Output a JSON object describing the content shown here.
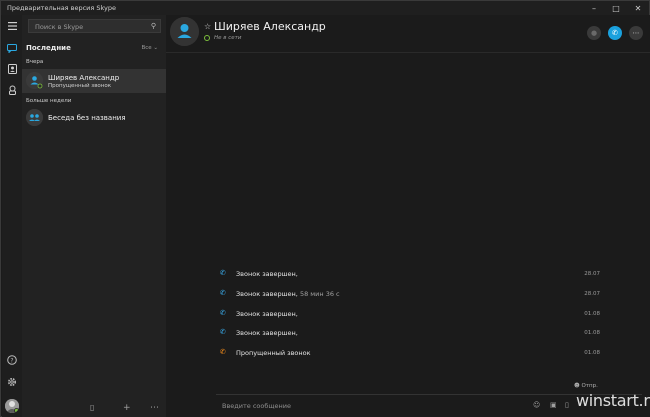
{
  "window": {
    "title": "Предварительная версия Skype",
    "controls": [
      "minimize",
      "maximize",
      "close"
    ]
  },
  "sidebar": {
    "search_placeholder": "Поиск в Skype",
    "section_title": "Последние",
    "filter_label": "Все",
    "groups": [
      {
        "label": "Вчера",
        "items": [
          {
            "name": "Ширяев Александр",
            "subtitle": "Пропущенный звонок",
            "selected": true
          }
        ]
      },
      {
        "label": "Больше недели",
        "items": [
          {
            "name": "Беседа без названия",
            "subtitle": "",
            "selected": false
          }
        ]
      }
    ]
  },
  "contact": {
    "name": "Ширяев Александр",
    "status": "Не в сети"
  },
  "messages": [
    {
      "type": "call-ended",
      "text": "Звонок завершен,",
      "duration": "",
      "time": "28.07"
    },
    {
      "type": "call-ended",
      "text": "Звонок завершен,",
      "duration": "58 мин 36 с",
      "time": "28.07"
    },
    {
      "type": "call-ended",
      "text": "Звонок завершен,",
      "duration": "",
      "time": "01.08"
    },
    {
      "type": "call-ended",
      "text": "Звонок завершен,",
      "duration": "",
      "time": "01.08"
    },
    {
      "type": "missed-call",
      "text": "Пропущенный звонок",
      "duration": "",
      "time": "01.08"
    }
  ],
  "read_receipt": "Отпр.",
  "compose": {
    "placeholder": "Введите сообщение"
  },
  "watermark": "winstart.ru",
  "colors": {
    "accent": "#1aa1de",
    "missed": "#f08a1c",
    "online_ring": "#7cbf3c",
    "background": "#1b1b1b"
  }
}
